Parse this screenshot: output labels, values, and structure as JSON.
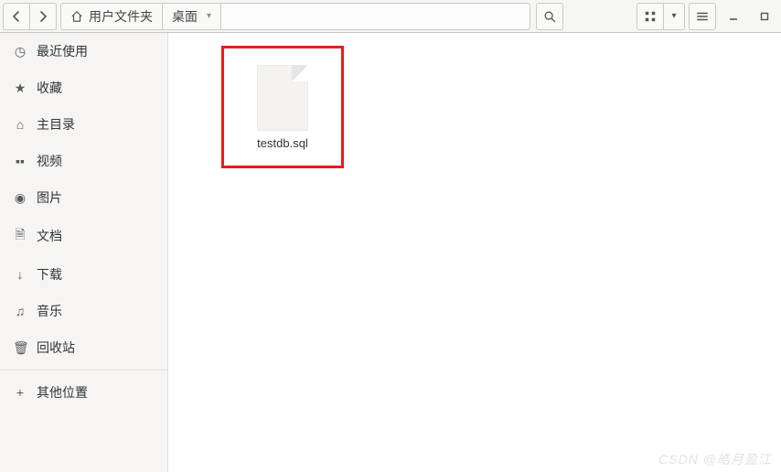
{
  "path": {
    "home_label": "用户文件夹",
    "desktop_label": "桌面"
  },
  "sidebar": {
    "recent": "最近使用",
    "starred": "收藏",
    "home": "主目录",
    "videos": "视频",
    "pictures": "图片",
    "documents": "文档",
    "downloads": "下载",
    "music": "音乐",
    "trash": "回收站",
    "other": "其他位置"
  },
  "files": [
    {
      "name": "testdb.sql"
    }
  ],
  "watermark": "CSDN @皓月盈江"
}
